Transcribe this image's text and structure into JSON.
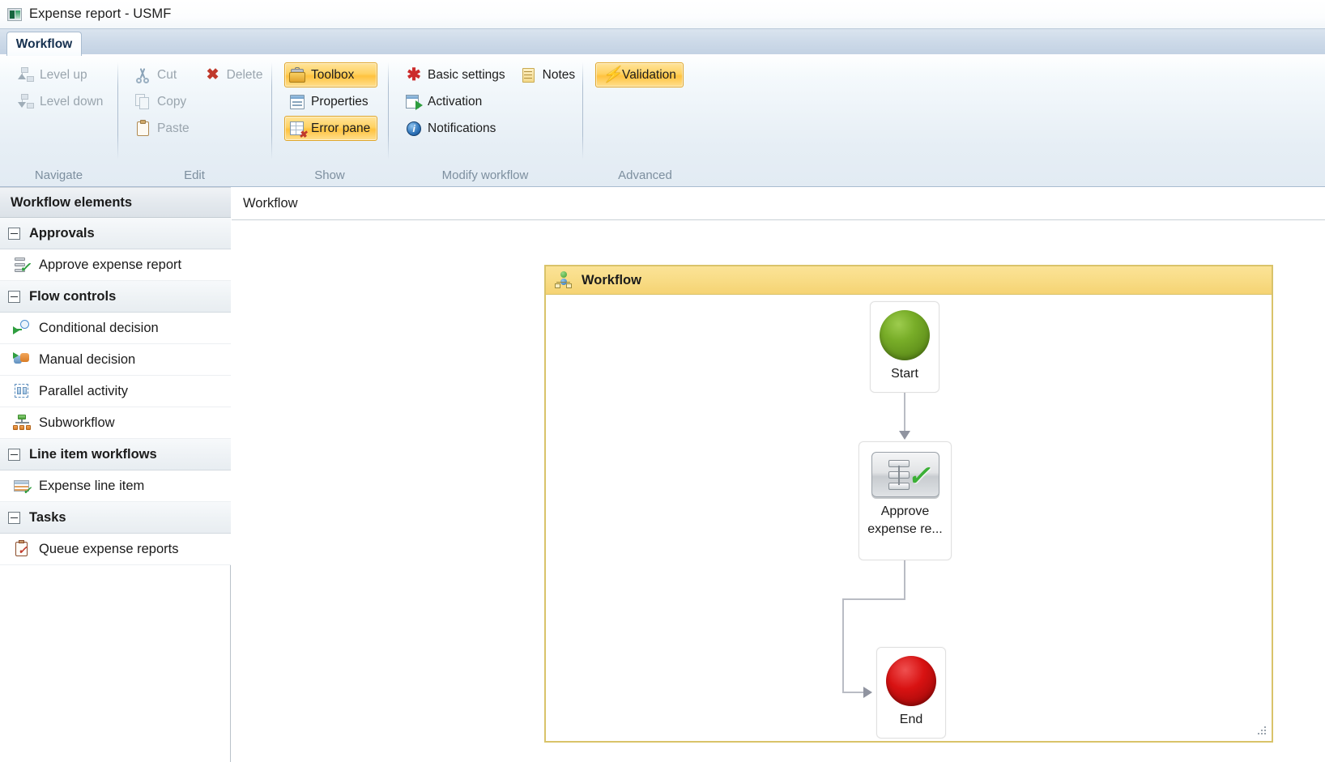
{
  "window": {
    "title": "Expense report - USMF",
    "icon": "application-icon"
  },
  "ribbon": {
    "tab": "Workflow",
    "groups": [
      {
        "label": "Navigate",
        "items": [
          {
            "label": "Level up",
            "icon": "level-up-icon",
            "state": "disabled"
          },
          {
            "label": "Level down",
            "icon": "level-down-icon",
            "state": "disabled"
          }
        ]
      },
      {
        "label": "Edit",
        "items": [
          {
            "label": "Cut",
            "icon": "scissors-icon",
            "state": "disabled"
          },
          {
            "label": "Copy",
            "icon": "copy-icon",
            "state": "disabled"
          },
          {
            "label": "Paste",
            "icon": "clipboard-icon",
            "state": "disabled"
          },
          {
            "label": "Delete",
            "icon": "delete-x-icon",
            "state": "disabled"
          }
        ]
      },
      {
        "label": "Show",
        "items": [
          {
            "label": "Toolbox",
            "icon": "toolbox-icon",
            "state": "active"
          },
          {
            "label": "Properties",
            "icon": "properties-icon",
            "state": "normal"
          },
          {
            "label": "Error pane",
            "icon": "error-pane-icon",
            "state": "active"
          }
        ]
      },
      {
        "label": "Modify workflow",
        "items": [
          {
            "label": "Basic settings",
            "icon": "asterisk-icon",
            "state": "normal"
          },
          {
            "label": "Activation",
            "icon": "activation-icon",
            "state": "normal"
          },
          {
            "label": "Notifications",
            "icon": "notifications-icon",
            "state": "normal"
          },
          {
            "label": "Notes",
            "icon": "notes-icon",
            "state": "normal"
          }
        ]
      },
      {
        "label": "Advanced",
        "items": [
          {
            "label": "Validation",
            "icon": "validation-bolt-icon",
            "state": "active"
          }
        ]
      }
    ]
  },
  "sidebar": {
    "header": "Workflow elements",
    "groups": [
      {
        "title": "Approvals",
        "expander": "collapse-icon",
        "items": [
          {
            "label": "Approve expense report",
            "icon": "approve-expense-icon"
          }
        ]
      },
      {
        "title": "Flow controls",
        "expander": "collapse-icon",
        "items": [
          {
            "label": "Conditional decision",
            "icon": "conditional-decision-icon"
          },
          {
            "label": "Manual decision",
            "icon": "manual-decision-icon"
          },
          {
            "label": "Parallel activity",
            "icon": "parallel-activity-icon"
          },
          {
            "label": "Subworkflow",
            "icon": "subworkflow-icon"
          }
        ]
      },
      {
        "title": "Line item workflows",
        "expander": "collapse-icon",
        "items": [
          {
            "label": "Expense line item",
            "icon": "expense-line-item-icon"
          }
        ]
      },
      {
        "title": "Tasks",
        "expander": "collapse-icon",
        "items": [
          {
            "label": "Queue expense reports",
            "icon": "queue-expense-reports-icon"
          }
        ]
      }
    ]
  },
  "breadcrumb": {
    "text": "Workflow"
  },
  "canvas": {
    "container": {
      "title": "Workflow",
      "icon": "workflow-diagram-icon",
      "border_color": "#d9c36a",
      "header_color": "#f8dc86"
    },
    "nodes": [
      {
        "id": "start",
        "label": "Start",
        "shape": "circle",
        "color": "#78ad28",
        "icon": "start-node-icon"
      },
      {
        "id": "task",
        "label_line1": "Approve",
        "label_line2": "expense re...",
        "shape": "task",
        "icon": "approval-task-icon"
      },
      {
        "id": "end",
        "label": "End",
        "shape": "circle",
        "color": "#d81212",
        "icon": "end-node-icon"
      }
    ],
    "connectors": [
      {
        "from": "start",
        "to": "task",
        "style": "straight-down",
        "arrow": "arrow-down"
      },
      {
        "from": "task",
        "to": "end",
        "style": "elbow-left-down",
        "arrow": "arrow-right"
      }
    ],
    "resize_grip": "resize-grip-icon"
  }
}
